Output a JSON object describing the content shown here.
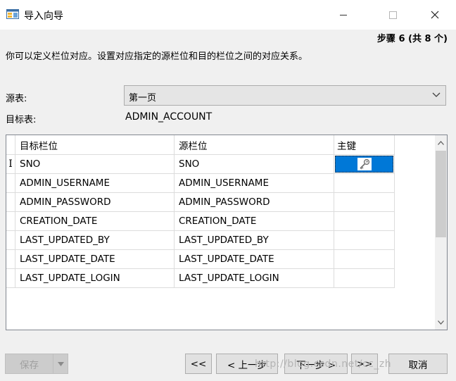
{
  "window": {
    "title": "导入向导",
    "minimize_label": "—",
    "maximize_label": "☐",
    "close_label": "✕"
  },
  "step_indicator": "步骤 6 (共 8 个)",
  "description": "你可以定义栏位对应。设置对应指定的源栏位和目的栏位之间的对应关系。",
  "source": {
    "label": "源表:",
    "selected": "第一页"
  },
  "target": {
    "label": "目标表:",
    "value": "ADMIN_ACCOUNT"
  },
  "grid": {
    "headers": [
      "目标栏位",
      "源栏位",
      "主键"
    ],
    "current_row_marker": "I",
    "rows": [
      {
        "target": "SNO",
        "source": "SNO",
        "primary_key": true
      },
      {
        "target": "ADMIN_USERNAME",
        "source": "ADMIN_USERNAME",
        "primary_key": false
      },
      {
        "target": "ADMIN_PASSWORD",
        "source": "ADMIN_PASSWORD",
        "primary_key": false
      },
      {
        "target": "CREATION_DATE",
        "source": "CREATION_DATE",
        "primary_key": false
      },
      {
        "target": "LAST_UPDATED_BY",
        "source": "LAST_UPDATED_BY",
        "primary_key": false
      },
      {
        "target": "LAST_UPDATE_DATE",
        "source": "LAST_UPDATE_DATE",
        "primary_key": false
      },
      {
        "target": "LAST_UPDATE_LOGIN",
        "source": "LAST_UPDATE_LOGIN",
        "primary_key": false
      }
    ]
  },
  "buttons": {
    "save": "保存",
    "first": "<<",
    "prev": "< 上一步",
    "next": "下一步 >",
    "last": ">>",
    "cancel": "取消"
  },
  "watermark": "http://blog.csdn.net/cc_zh",
  "colors": {
    "selection": "#0078d7",
    "window_bg": "#f0f0f0"
  },
  "icons": {
    "app": "import-wizard-icon",
    "primary_key": "key-icon"
  }
}
